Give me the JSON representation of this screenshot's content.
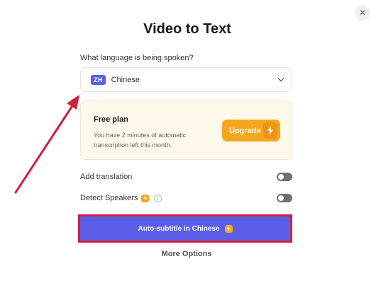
{
  "dialog": {
    "title": "Video to Text",
    "close_icon": "close-icon"
  },
  "language": {
    "question": "What language is being spoken?",
    "badge": "ZH",
    "selected": "Chinese"
  },
  "plan": {
    "title": "Free plan",
    "description": "You have 2 minutes of automatic transcription left this month.",
    "upgrade_label": "Upgrade"
  },
  "options": {
    "add_translation": {
      "label": "Add translation",
      "enabled": false
    },
    "detect_speakers": {
      "label": "Detect Speakers",
      "enabled": false,
      "info": "i"
    }
  },
  "actions": {
    "primary_label": "Auto-subtitle in Chinese",
    "more_options": "More Options"
  },
  "colors": {
    "accent": "#5b5fe8",
    "upgrade": "#f6a51f",
    "highlight_annotation": "#d21f3c"
  }
}
